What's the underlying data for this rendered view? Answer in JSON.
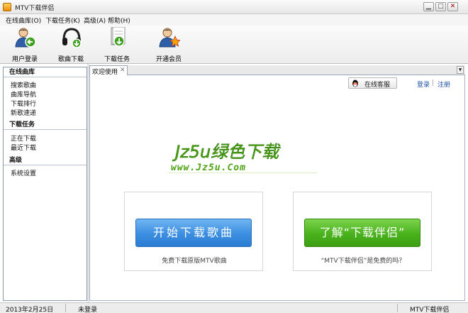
{
  "window": {
    "title": "MTV下载伴侣",
    "controls": {
      "minimize": "▁",
      "maximize": "□",
      "close": "✕"
    }
  },
  "menu": [
    "在线曲库(O)",
    "下载任务(K)",
    "高级(A)",
    "帮助(H)"
  ],
  "toolbar": [
    {
      "label": "用户登录",
      "icon": "user-login-icon"
    },
    {
      "label": "歌曲下载",
      "icon": "headphones-icon"
    },
    {
      "label": "下载任务",
      "icon": "download-task-icon"
    },
    {
      "label": "开通会员",
      "icon": "vip-member-icon"
    }
  ],
  "sidebar": {
    "sections": [
      {
        "title": "在线曲库",
        "items": [
          "搜索歌曲",
          "曲库导航",
          "下载排行",
          "新歌速递"
        ]
      },
      {
        "title": "下载任务",
        "items": [
          "正在下载",
          "最近下载"
        ]
      },
      {
        "title": "高级",
        "items": [
          "系统设置"
        ]
      }
    ]
  },
  "tab": {
    "label": "欢迎使用",
    "close": "✕",
    "dropdown": "▼"
  },
  "content": {
    "customer_service": "在线客服",
    "login": "登录",
    "separator": "|",
    "register": "注册",
    "logo_text": "Jz5u绿色下载",
    "logo_url": "www.Jz5u.Com",
    "left_panel": {
      "button": "开始下载歌曲",
      "note": "免费下载原版MTV歌曲"
    },
    "right_panel": {
      "button": "了解“下载伴侣”",
      "note": "“MTV下载伴侣”是免费的吗？"
    }
  },
  "status": {
    "date": "2013年2月25日",
    "login": "未登录",
    "app": "MTV下载伴侣"
  },
  "colors": {
    "accent_blue": "#3b8ee0",
    "accent_green": "#49b21c",
    "logo_green": "#4ea316",
    "link": "#1d4fa8"
  }
}
